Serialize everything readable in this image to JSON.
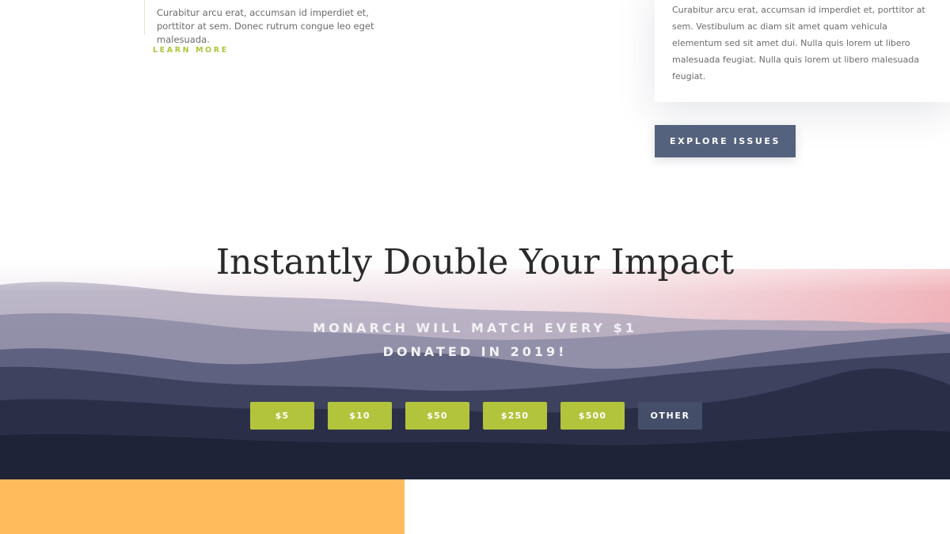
{
  "feature_left": {
    "text": "Curabitur arcu erat, accumsan id imperdiet et, porttitor at sem. Donec rutrum congue leo eget malesuada.",
    "link_label": "LEARN MORE"
  },
  "card": {
    "text": "Curabitur arcu erat, accumsan id imperdiet et, porttitor at sem. Vestibulum ac diam sit amet quam vehicula elementum sed sit amet dui. Nulla quis lorem ut libero malesuada feugiat. Nulla quis lorem ut libero malesuada feugiat."
  },
  "explore_button": "EXPLORE ISSUES",
  "hero": {
    "title": "Instantly Double Your Impact",
    "subtitle_line1": "MONARCH WILL MATCH EVERY $1",
    "subtitle_line2": "DONATED IN 2019!",
    "amounts": [
      "$5",
      "$10",
      "$50",
      "$250",
      "$500"
    ],
    "other_label": "OTHER"
  },
  "colors": {
    "accent_green": "#b2c43c",
    "button_slate": "#55627d",
    "other_button": "#444e69",
    "orange_block": "#ffbb5c"
  }
}
